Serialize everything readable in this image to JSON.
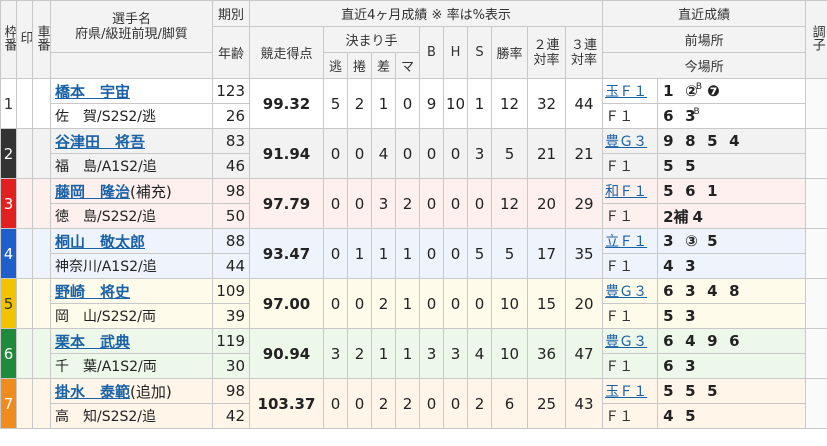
{
  "header": {
    "waku": "枠番",
    "shirushi": "印",
    "sha": "車番",
    "senshu_line1": "選手名",
    "senshu_line2": "府県/級班前現/脚質",
    "kibetsu": "期別",
    "nenrei": "年齢",
    "stats_title": "直近4ヶ月成績 ※ 率は%表示",
    "kyoso": "競走得点",
    "kimarite": "決まり手",
    "nige": "逃",
    "makuri": "捲",
    "sashi": "差",
    "mark": "マ",
    "b": "B",
    "h": "H",
    "s": "S",
    "shoritsu": "勝率",
    "niren_1": "２連",
    "niren_2": "対率",
    "sanren_1": "３連",
    "sanren_2": "対率",
    "recent_title": "直近成績",
    "zen": "前場所",
    "kon": "今場所",
    "chosi": "調子"
  },
  "colors": {
    "waku_1": "#ffffff",
    "waku_2": "#333333",
    "waku_3": "#e22020",
    "waku_4": "#1f5fcc",
    "waku_5": "#f2c400",
    "waku_6": "#1e8a3a",
    "waku_7": "#f08c1e"
  },
  "riders": [
    {
      "no": "1",
      "name": "橋本　宇宙",
      "pref": "佐　賀/S2S2/逃",
      "ki": "123",
      "age": "26",
      "score": "99.32",
      "nige": "5",
      "makuri": "2",
      "sashi": "1",
      "mark": "0",
      "b": "9",
      "h": "10",
      "s": "1",
      "win": "12",
      "ren2": "32",
      "ren3": "44",
      "prev_place": "玉Ｆ１",
      "prev": [
        "1",
        "②",
        "❼"
      ],
      "prev_sup": "B",
      "cur_place": "Ｆ１",
      "cur": [
        "6",
        "3"
      ],
      "cur_sup": "B"
    },
    {
      "no": "2",
      "name": "谷津田　将吾",
      "pref": "福　島/A1S2/追",
      "ki": "83",
      "age": "46",
      "score": "91.94",
      "nige": "0",
      "makuri": "0",
      "sashi": "4",
      "mark": "0",
      "b": "0",
      "h": "0",
      "s": "3",
      "win": "5",
      "ren2": "21",
      "ren3": "21",
      "prev_place": "豊Ｇ３",
      "prev": [
        "9",
        "8",
        "5",
        "4"
      ],
      "cur_place": "Ｆ１",
      "cur": [
        "5",
        "5"
      ]
    },
    {
      "no": "3",
      "name": "藤岡　隆治",
      "name_suffix": "(補充)",
      "pref": "徳　島/S2S2/追",
      "ki": "98",
      "age": "50",
      "score": "97.79",
      "nige": "0",
      "makuri": "0",
      "sashi": "3",
      "mark": "2",
      "b": "0",
      "h": "0",
      "s": "0",
      "win": "12",
      "ren2": "20",
      "ren3": "29",
      "prev_place": "和Ｆ１",
      "prev": [
        "5",
        "6",
        "1"
      ],
      "cur_place": "Ｆ１",
      "cur": [
        "2補",
        "4"
      ]
    },
    {
      "no": "4",
      "name": "桐山　敬太郎",
      "pref": "神奈川/A1S2/追",
      "ki": "88",
      "age": "44",
      "score": "93.47",
      "nige": "0",
      "makuri": "1",
      "sashi": "1",
      "mark": "1",
      "b": "0",
      "h": "0",
      "s": "5",
      "win": "5",
      "ren2": "17",
      "ren3": "35",
      "prev_place": "立Ｆ１",
      "prev": [
        "3",
        "③",
        "5"
      ],
      "cur_place": "Ｆ１",
      "cur": [
        "4",
        "3"
      ]
    },
    {
      "no": "5",
      "name": "野崎　将史",
      "pref": "岡　山/S2S2/両",
      "ki": "109",
      "age": "39",
      "score": "97.00",
      "nige": "0",
      "makuri": "0",
      "sashi": "2",
      "mark": "1",
      "b": "0",
      "h": "0",
      "s": "0",
      "win": "10",
      "ren2": "15",
      "ren3": "20",
      "prev_place": "豊Ｇ３",
      "prev": [
        "6",
        "3",
        "4",
        "8"
      ],
      "cur_place": "Ｆ１",
      "cur": [
        "5",
        "3"
      ]
    },
    {
      "no": "6",
      "name": "栗本　武典",
      "pref": "千　葉/A1S2/両",
      "ki": "119",
      "age": "30",
      "score": "90.94",
      "nige": "3",
      "makuri": "2",
      "sashi": "1",
      "mark": "1",
      "b": "3",
      "h": "3",
      "s": "4",
      "win": "10",
      "ren2": "36",
      "ren3": "47",
      "prev_place": "豊Ｇ３",
      "prev": [
        "6",
        "4",
        "9",
        "6"
      ],
      "cur_place": "Ｆ１",
      "cur": [
        "6",
        "3"
      ]
    },
    {
      "no": "7",
      "name": "掛水　泰範",
      "name_suffix": "(追加)",
      "pref": "高　知/S2S2/追",
      "ki": "98",
      "age": "42",
      "score": "103.37",
      "nige": "0",
      "makuri": "0",
      "sashi": "2",
      "mark": "2",
      "b": "0",
      "h": "0",
      "s": "2",
      "win": "6",
      "ren2": "25",
      "ren3": "43",
      "prev_place": "玉Ｆ１",
      "prev": [
        "5",
        "5",
        "5"
      ],
      "cur_place": "Ｆ１",
      "cur": [
        "4",
        "5"
      ]
    }
  ]
}
